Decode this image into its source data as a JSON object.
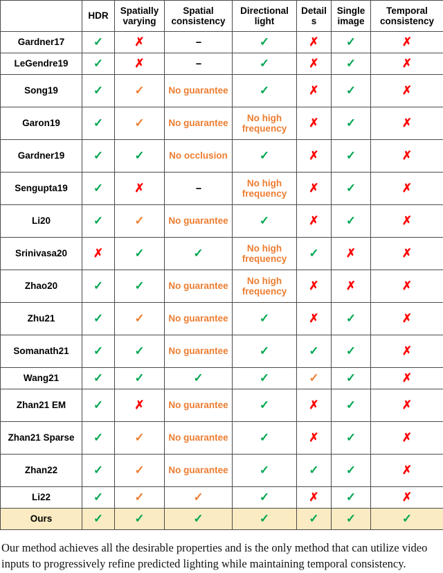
{
  "table": {
    "columns": [
      {
        "id": "method",
        "label": ""
      },
      {
        "id": "hdr",
        "label": "HDR"
      },
      {
        "id": "spatially_varying",
        "label": "Spatially varying"
      },
      {
        "id": "spatial_consistency",
        "label": "Spatial consistency"
      },
      {
        "id": "directional_light",
        "label": "Directional light"
      },
      {
        "id": "details",
        "label": "Detail s"
      },
      {
        "id": "single_image",
        "label": "Single image"
      },
      {
        "id": "temporal_consistency",
        "label": "Temporal consistency"
      }
    ],
    "marks": {
      "check": "✓",
      "check_warn": "✓",
      "cross": "✗",
      "dash": "--"
    },
    "colors": {
      "check_green": "#00A651",
      "check_orange": "#ED7D31",
      "cross_red": "#FF0000",
      "note_orange": "#ED7D31",
      "highlight_row": "#FBEBC2",
      "border": "#4A4A4A"
    },
    "rows": [
      {
        "method": "Gardner17",
        "highlight": false,
        "lines": 1,
        "cells": [
          {
            "kind": "check"
          },
          {
            "kind": "cross"
          },
          {
            "kind": "dash"
          },
          {
            "kind": "check"
          },
          {
            "kind": "cross"
          },
          {
            "kind": "check"
          },
          {
            "kind": "cross"
          }
        ]
      },
      {
        "method": "LeGendre19",
        "highlight": false,
        "lines": 1,
        "cells": [
          {
            "kind": "check"
          },
          {
            "kind": "cross"
          },
          {
            "kind": "dash"
          },
          {
            "kind": "check"
          },
          {
            "kind": "cross"
          },
          {
            "kind": "check"
          },
          {
            "kind": "cross"
          }
        ]
      },
      {
        "method": "Song19",
        "highlight": false,
        "lines": 2,
        "cells": [
          {
            "kind": "check"
          },
          {
            "kind": "check_warn"
          },
          {
            "kind": "note",
            "text": "No guarantee"
          },
          {
            "kind": "check"
          },
          {
            "kind": "cross"
          },
          {
            "kind": "check"
          },
          {
            "kind": "cross"
          }
        ]
      },
      {
        "method": "Garon19",
        "highlight": false,
        "lines": 2,
        "cells": [
          {
            "kind": "check"
          },
          {
            "kind": "check_warn"
          },
          {
            "kind": "note",
            "text": "No guarantee"
          },
          {
            "kind": "note",
            "text": "No high frequency"
          },
          {
            "kind": "cross"
          },
          {
            "kind": "check"
          },
          {
            "kind": "cross"
          }
        ]
      },
      {
        "method": "Gardner19",
        "highlight": false,
        "lines": 2,
        "cells": [
          {
            "kind": "check"
          },
          {
            "kind": "check"
          },
          {
            "kind": "note",
            "text": "No occlusion"
          },
          {
            "kind": "check"
          },
          {
            "kind": "cross"
          },
          {
            "kind": "check"
          },
          {
            "kind": "cross"
          }
        ]
      },
      {
        "method": "Sengupta19",
        "highlight": false,
        "lines": 2,
        "cells": [
          {
            "kind": "check"
          },
          {
            "kind": "cross"
          },
          {
            "kind": "dash"
          },
          {
            "kind": "note",
            "text": "No high frequency"
          },
          {
            "kind": "cross"
          },
          {
            "kind": "check"
          },
          {
            "kind": "cross"
          }
        ]
      },
      {
        "method": "Li20",
        "highlight": false,
        "lines": 2,
        "cells": [
          {
            "kind": "check"
          },
          {
            "kind": "check_warn"
          },
          {
            "kind": "note",
            "text": "No guarantee"
          },
          {
            "kind": "check"
          },
          {
            "kind": "cross"
          },
          {
            "kind": "check"
          },
          {
            "kind": "cross"
          }
        ]
      },
      {
        "method": "Srinivasa20",
        "highlight": false,
        "lines": 2,
        "cells": [
          {
            "kind": "cross"
          },
          {
            "kind": "check"
          },
          {
            "kind": "check"
          },
          {
            "kind": "note",
            "text": "No high frequency"
          },
          {
            "kind": "check"
          },
          {
            "kind": "cross"
          },
          {
            "kind": "cross"
          }
        ]
      },
      {
        "method": "Zhao20",
        "highlight": false,
        "lines": 2,
        "cells": [
          {
            "kind": "check"
          },
          {
            "kind": "check"
          },
          {
            "kind": "note",
            "text": "No guarantee"
          },
          {
            "kind": "note",
            "text": "No high frequency"
          },
          {
            "kind": "cross"
          },
          {
            "kind": "cross"
          },
          {
            "kind": "cross"
          }
        ]
      },
      {
        "method": "Zhu21",
        "highlight": false,
        "lines": 2,
        "cells": [
          {
            "kind": "check"
          },
          {
            "kind": "check_warn"
          },
          {
            "kind": "note",
            "text": "No guarantee"
          },
          {
            "kind": "check"
          },
          {
            "kind": "cross"
          },
          {
            "kind": "check"
          },
          {
            "kind": "cross"
          }
        ]
      },
      {
        "method": "Somanath21",
        "highlight": false,
        "lines": 2,
        "cells": [
          {
            "kind": "check"
          },
          {
            "kind": "check"
          },
          {
            "kind": "note",
            "text": "No guarantee"
          },
          {
            "kind": "check"
          },
          {
            "kind": "check"
          },
          {
            "kind": "check"
          },
          {
            "kind": "cross"
          }
        ]
      },
      {
        "method": "Wang21",
        "highlight": false,
        "lines": 1,
        "cells": [
          {
            "kind": "check"
          },
          {
            "kind": "check"
          },
          {
            "kind": "check"
          },
          {
            "kind": "check"
          },
          {
            "kind": "check_warn"
          },
          {
            "kind": "check"
          },
          {
            "kind": "cross"
          }
        ]
      },
      {
        "method": "Zhan21 EM",
        "highlight": false,
        "lines": 2,
        "cells": [
          {
            "kind": "check"
          },
          {
            "kind": "cross"
          },
          {
            "kind": "note",
            "text": "No guarantee"
          },
          {
            "kind": "check"
          },
          {
            "kind": "cross"
          },
          {
            "kind": "check"
          },
          {
            "kind": "cross"
          }
        ]
      },
      {
        "method": "Zhan21 Sparse",
        "highlight": false,
        "lines": 2,
        "cells": [
          {
            "kind": "check"
          },
          {
            "kind": "check_warn"
          },
          {
            "kind": "note",
            "text": "No guarantee"
          },
          {
            "kind": "check"
          },
          {
            "kind": "cross"
          },
          {
            "kind": "check"
          },
          {
            "kind": "cross"
          }
        ]
      },
      {
        "method": "Zhan22",
        "highlight": false,
        "lines": 2,
        "cells": [
          {
            "kind": "check"
          },
          {
            "kind": "check_warn"
          },
          {
            "kind": "note",
            "text": "No guarantee"
          },
          {
            "kind": "check"
          },
          {
            "kind": "check"
          },
          {
            "kind": "check"
          },
          {
            "kind": "cross"
          }
        ]
      },
      {
        "method": "Li22",
        "highlight": false,
        "lines": 1,
        "cells": [
          {
            "kind": "check"
          },
          {
            "kind": "check_warn"
          },
          {
            "kind": "check_warn"
          },
          {
            "kind": "check"
          },
          {
            "kind": "cross"
          },
          {
            "kind": "check"
          },
          {
            "kind": "cross"
          }
        ]
      },
      {
        "method": "Ours",
        "highlight": true,
        "lines": 1,
        "cells": [
          {
            "kind": "check"
          },
          {
            "kind": "check"
          },
          {
            "kind": "check"
          },
          {
            "kind": "check"
          },
          {
            "kind": "check"
          },
          {
            "kind": "check"
          },
          {
            "kind": "check"
          }
        ]
      }
    ]
  },
  "caption": {
    "text": "Our method achieves all the desirable properties and is the only method that can utilize video inputs to progressively refine predicted lighting while maintaining temporal consistency."
  }
}
